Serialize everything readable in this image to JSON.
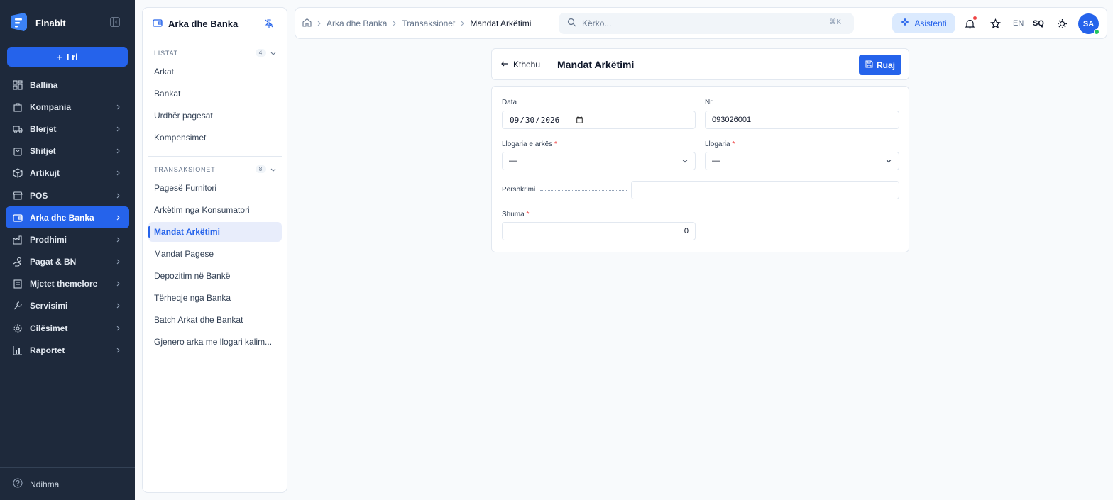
{
  "app": {
    "name": "Finabit",
    "new_label": "I ri",
    "help_label": "Ndihma"
  },
  "nav": [
    {
      "label": "Ballina",
      "icon": "dashboard-icon",
      "chevron": false
    },
    {
      "label": "Kompania",
      "icon": "building-icon",
      "chevron": true
    },
    {
      "label": "Blerjet",
      "icon": "truck-icon",
      "chevron": true
    },
    {
      "label": "Shitjet",
      "icon": "shopping-bag-icon",
      "chevron": true
    },
    {
      "label": "Artikujt",
      "icon": "box-icon",
      "chevron": true
    },
    {
      "label": "POS",
      "icon": "store-icon",
      "chevron": true
    },
    {
      "label": "Arka dhe Banka",
      "icon": "wallet-icon",
      "chevron": true,
      "active": true
    },
    {
      "label": "Prodhimi",
      "icon": "factory-icon",
      "chevron": true
    },
    {
      "label": "Pagat & BN",
      "icon": "hand-coins-icon",
      "chevron": true
    },
    {
      "label": "Mjetet themelore",
      "icon": "assets-icon",
      "chevron": true
    },
    {
      "label": "Servisimi",
      "icon": "wrench-icon",
      "chevron": true
    },
    {
      "label": "Cilësimet",
      "icon": "gear-icon",
      "chevron": true
    },
    {
      "label": "Raportet",
      "icon": "bar-chart-icon",
      "chevron": true
    }
  ],
  "panel": {
    "title": "Arka dhe Banka",
    "sections": [
      {
        "title": "LISTAT",
        "count": "4",
        "items": [
          "Arkat",
          "Bankat",
          "Urdhër pagesat",
          "Kompensimet"
        ]
      },
      {
        "title": "TRANSAKSIONET",
        "count": "8",
        "items": [
          "Pagesë Furnitori",
          "Arkëtim nga Konsumatori",
          "Mandat Arkëtimi",
          "Mandat Pagese",
          "Depozitim në Bankë",
          "Tërheqje nga Banka",
          "Batch Arkat dhe Bankat",
          "Gjenero arka me llogari kalim..."
        ]
      }
    ],
    "active_item": "Mandat Arkëtimi"
  },
  "breadcrumb": [
    "Arka dhe Banka",
    "Transaksionet",
    "Mandat Arkëtimi"
  ],
  "search": {
    "placeholder": "Kërko...",
    "shortcut": "⌘K"
  },
  "topbar": {
    "assistant_label": "Asistenti",
    "lang_en": "EN",
    "lang_sq": "SQ",
    "avatar": "SA"
  },
  "page": {
    "back_label": "Kthehu",
    "title": "Mandat Arkëtimi",
    "save_label": "Ruaj",
    "fields": {
      "data_label": "Data",
      "data_value": "2026-09-30",
      "nr_label": "Nr.",
      "nr_value": "093026001",
      "llogaria_arkes_label": "Llogaria e arkës",
      "llogaria_arkes_value": "—",
      "llogaria_label": "Llogaria",
      "llogaria_value": "—",
      "pershkrimi_label": "Përshkrimi",
      "pershkrimi_value": "",
      "shuma_label": "Shuma",
      "shuma_value": "0"
    }
  },
  "colors": {
    "sidebar": "#1e293b",
    "accent": "#2563eb",
    "required": "#ef4444"
  }
}
